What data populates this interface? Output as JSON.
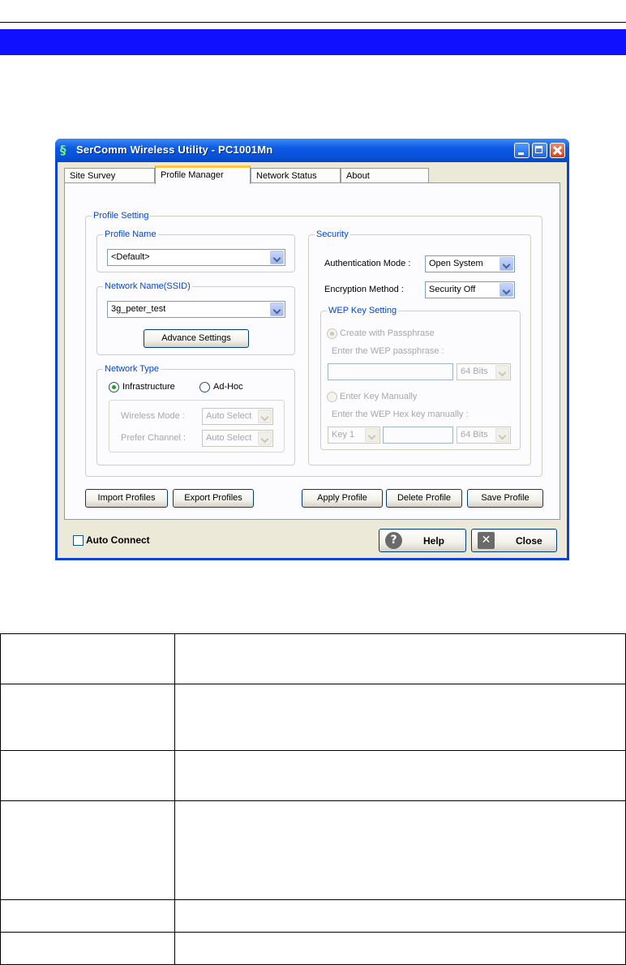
{
  "window": {
    "title": "SerComm Wireless Utility - PC1001Mn"
  },
  "tabs": [
    "Site Survey",
    "Profile Manager",
    "Network Status",
    "About"
  ],
  "profile_setting": {
    "label": "Profile Setting",
    "profile_name": {
      "label": "Profile Name",
      "value": "<Default>"
    },
    "ssid": {
      "label": "Network Name(SSID)",
      "value": "3g_peter_test"
    },
    "advance_button": "Advance Settings",
    "network_type": {
      "label": "Network Type",
      "infrastructure": "Infrastructure",
      "adhoc": "Ad-Hoc",
      "wireless_mode_label": "Wireless Mode :",
      "wireless_mode_value": "Auto Select",
      "prefer_channel_label": "Prefer Channel :",
      "prefer_channel_value": "Auto Select"
    }
  },
  "security": {
    "label": "Security",
    "auth_label": "Authentication Mode :",
    "auth_value": "Open System",
    "enc_label": "Encryption Method :",
    "enc_value": "Security Off",
    "wep": {
      "label": "WEP Key Setting",
      "passphrase_radio": "Create with Passphrase",
      "passphrase_prompt": "Enter the WEP passphrase :",
      "bits1": "64 Bits",
      "manual_radio": "Enter Key Manually",
      "manual_prompt": "Enter the WEP Hex key manually :",
      "key_index": "Key 1",
      "bits2": "64 Bits"
    }
  },
  "buttons": {
    "import": "Import Profiles",
    "export": "Export Profiles",
    "apply": "Apply  Profile",
    "delete": "Delete Profile",
    "save": "Save Profile"
  },
  "footer": {
    "auto_connect": "Auto Connect",
    "help": "Help",
    "close": "Close"
  }
}
